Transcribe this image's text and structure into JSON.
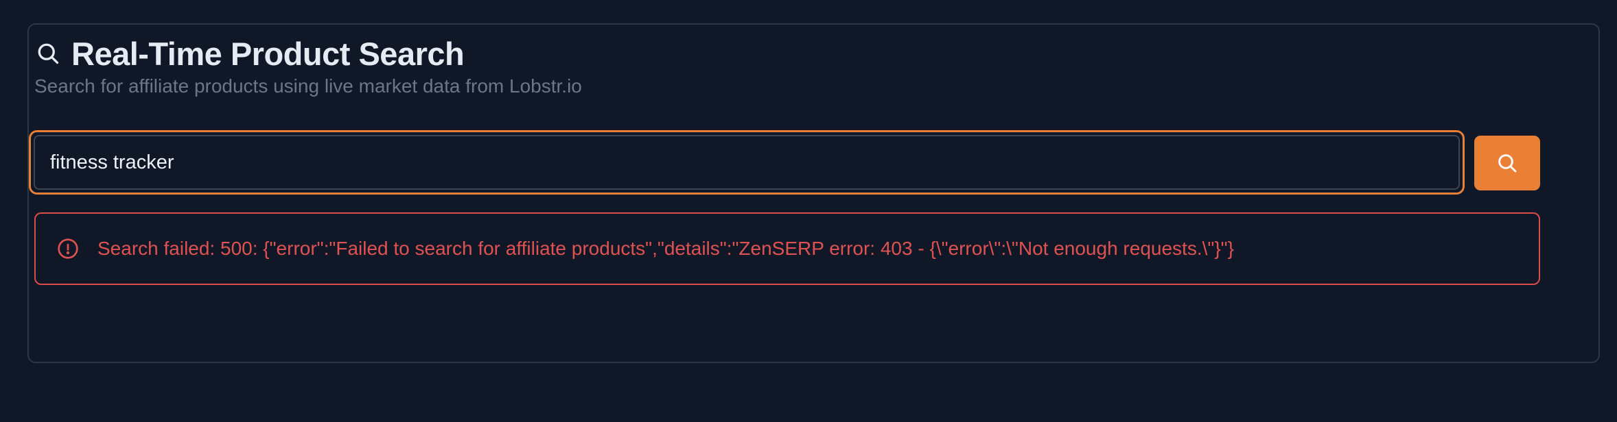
{
  "header": {
    "title": "Real-Time Product Search",
    "subtitle": "Search for affiliate products using live market data from Lobstr.io",
    "icon": "search-icon"
  },
  "search": {
    "value": "fitness tracker",
    "button_icon": "search-icon"
  },
  "error": {
    "icon": "alert-circle-icon",
    "message": "Search failed: 500: {\"error\":\"Failed to search for affiliate products\",\"details\":\"ZenSERP error: 403 - {\\\"error\\\":\\\"Not enough requests.\\\"}\"}"
  },
  "colors": {
    "background": "#101828",
    "accent": "#e98035",
    "error": "#e05252",
    "title": "#e6eaf2",
    "muted": "#6b7789"
  }
}
